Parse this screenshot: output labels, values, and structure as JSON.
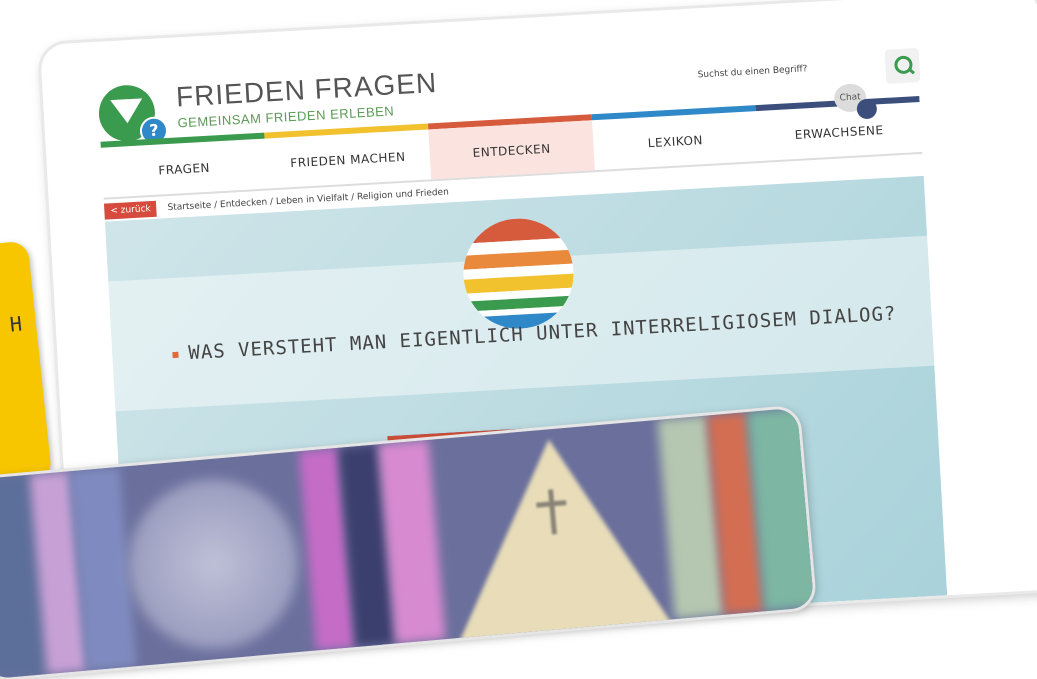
{
  "logo": {
    "title": "FRIEDEN FRAGEN",
    "subtitle": "GEMEINSAM FRIEDEN ERLEBEN",
    "badge": "?"
  },
  "search": {
    "placeholder": "Suchst du einen Begriff?",
    "icon": "search-icon"
  },
  "nav": {
    "items": [
      {
        "label": "FRAGEN",
        "color": "#3a9a4e"
      },
      {
        "label": "FRIEDEN MACHEN",
        "color": "#f2c12e"
      },
      {
        "label": "ENTDECKEN",
        "color": "#d65b3c"
      },
      {
        "label": "LEXIKON",
        "color": "#2f88c8"
      },
      {
        "label": "ERWACHSENE",
        "color": "#3b4e7c"
      }
    ],
    "active": "ENTDECKEN",
    "chat_label": "Chat"
  },
  "breadcrumb": {
    "back": "< zurück",
    "path": "Startseite / Entdecken / Leben in Vielfalt / Religion und Frieden"
  },
  "main": {
    "question": "WAS VERSTEHT MAN EIGENTLICH UNTER INTERRELIGIOSEM DIALOG?"
  },
  "badge_side": {
    "text": "H"
  },
  "colors": {
    "green": "#3a9a4e",
    "yellow": "#f2c12e",
    "red": "#d65b3c",
    "blue": "#2f88c8",
    "navy": "#3b4e7c"
  }
}
